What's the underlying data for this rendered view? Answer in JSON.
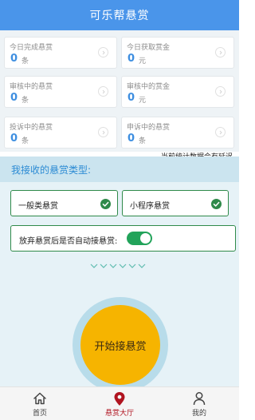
{
  "header": {
    "title": "可乐帮悬赏"
  },
  "stats": {
    "cards": [
      {
        "label": "今日完成悬赏",
        "value": "0",
        "unit": "条"
      },
      {
        "label": "今日获取赏金",
        "value": "0",
        "unit": "元"
      },
      {
        "label": "审核中的悬赏",
        "value": "0",
        "unit": "条"
      },
      {
        "label": "审核中的赏金",
        "value": "0",
        "unit": "元"
      },
      {
        "label": "投诉中的悬赏",
        "value": "0",
        "unit": "条"
      },
      {
        "label": "申诉中的悬赏",
        "value": "0",
        "unit": "条"
      }
    ],
    "note": "当前统计数据会有延迟"
  },
  "types": {
    "title": "我接收的悬赏类型:",
    "items": [
      {
        "label": "一般类悬赏",
        "checked": true
      },
      {
        "label": "小程序悬赏",
        "checked": true
      }
    ],
    "auto_accept": {
      "label": "放弃悬赏后是否自动接悬赏:",
      "on": true
    }
  },
  "start": {
    "label": "开始接悬赏"
  },
  "tabbar": {
    "items": [
      {
        "label": "首页",
        "icon": "home-icon",
        "active": false
      },
      {
        "label": "悬赏大厅",
        "icon": "location-pin-icon",
        "active": true
      },
      {
        "label": "我的",
        "icon": "user-icon",
        "active": false
      }
    ]
  },
  "colors": {
    "header": "#4a95ea",
    "value": "#3d8ee0",
    "check": "#2f8a4a",
    "toggle": "#22a35a",
    "start_button": "#f6b400",
    "active_tab": "#b01420"
  }
}
